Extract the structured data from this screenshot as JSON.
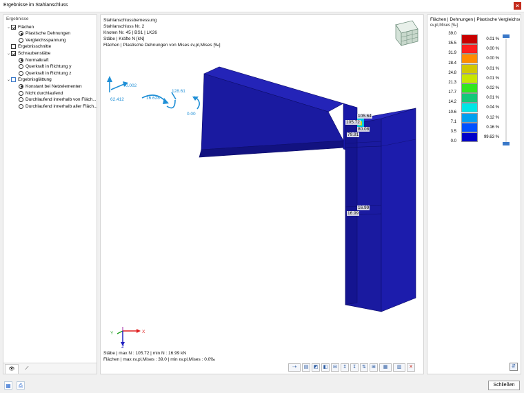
{
  "window": {
    "title": "Ergebnisse im Stahlanschluss",
    "close_glyph": "×"
  },
  "left_panel": {
    "header": "Ergebnisse",
    "tree": [
      {
        "type": "checkbox",
        "level": 0,
        "chevron": "⌄",
        "checked": true,
        "label": "Flächen"
      },
      {
        "type": "radio",
        "level": 1,
        "checked": true,
        "label": "Plastische Dehnungen"
      },
      {
        "type": "radio",
        "level": 1,
        "checked": false,
        "label": "Vergleichsspannung"
      },
      {
        "type": "checkbox",
        "level": 0,
        "chevron": "",
        "checked": false,
        "label": "Ergebnisschnitte"
      },
      {
        "type": "checkbox",
        "level": 0,
        "chevron": "⌄",
        "checked": true,
        "label": "Schraubenstäbe"
      },
      {
        "type": "radio",
        "level": 1,
        "checked": true,
        "label": "Normalkraft"
      },
      {
        "type": "radio",
        "level": 1,
        "checked": false,
        "label": "Querkraft in Richtung y"
      },
      {
        "type": "radio",
        "level": 1,
        "checked": false,
        "label": "Querkraft in Richtung z"
      },
      {
        "type": "checkbox",
        "level": 0,
        "chevron": "⌄",
        "checked": false,
        "partial": true,
        "label": "Ergebnisglättung"
      },
      {
        "type": "radio",
        "level": 1,
        "checked": true,
        "label": "Konstant bei Netzelementen"
      },
      {
        "type": "radio",
        "level": 1,
        "checked": false,
        "label": "Nicht durchlaufend"
      },
      {
        "type": "radio",
        "level": 1,
        "checked": false,
        "label": "Durchlaufend innerhalb von Fläch..."
      },
      {
        "type": "radio",
        "level": 1,
        "checked": false,
        "label": "Durchlaufend innerhalb aller Fläch..."
      }
    ],
    "tabs": [
      {
        "icon": "eye-icon",
        "glyph": "👁"
      },
      {
        "icon": "bolt-icon",
        "glyph": "⟋"
      }
    ]
  },
  "viewport": {
    "info_lines": [
      "Stahlanschlussbemessung",
      "Stahlanschluss Nr. 2",
      "Knoten Nr. 45 | BS1 | LK26",
      "Stäbe | Kräfte N [kN]",
      "Flächen | Plastische Dehnungen von Mises εv,pl,Mises [‰]"
    ],
    "bottom_lines": [
      "Stäbe | max N : 105.72 | min N : 16.99 kN",
      "Flächen | max εv,pl,Mises : 39.0 | min εv,pl,Mises : 0.0‰"
    ],
    "load_labels": [
      "0.002",
      "62.412",
      "16.628",
      "128.61",
      "0.00"
    ],
    "bolt_labels": [
      "105.64",
      "105.72",
      "80.08",
      "79.91",
      "16.99",
      "16.99"
    ],
    "axis_labels": {
      "x": "X",
      "y": "Y",
      "z": "Z"
    },
    "colors": {
      "steel": "#1a1aa0",
      "steel_dark": "#121280",
      "steel_light": "#2424b8",
      "load": "#1f8fd6"
    }
  },
  "right_panel": {
    "title": "Flächen | Dehnungen | Plastische Vergleichsc",
    "subtitle": "εv,pl,Mises [‰]",
    "legend": [
      {
        "value": "39.0",
        "color": "#c80000",
        "pct": "0.01 %"
      },
      {
        "value": "35.5",
        "color": "#ff1e1e",
        "pct": "0.00 %"
      },
      {
        "value": "31.9",
        "color": "#ff8c00",
        "pct": "0.00 %"
      },
      {
        "value": "28.4",
        "color": "#d2c800",
        "pct": "0.01 %"
      },
      {
        "value": "24.8",
        "color": "#c8e600",
        "pct": "0.01 %"
      },
      {
        "value": "21.3",
        "color": "#32e61e",
        "pct": "0.02 %"
      },
      {
        "value": "17.7",
        "color": "#14c87a",
        "pct": "0.01 %"
      },
      {
        "value": "14.2",
        "color": "#00e6e6",
        "pct": "0.04 %"
      },
      {
        "value": "10.6",
        "color": "#00a0f0",
        "pct": "0.12 %"
      },
      {
        "value": "7.1",
        "color": "#0050ff",
        "pct": "0.16 %"
      },
      {
        "value": "3.5",
        "color": "#0000c8",
        "pct": "99.63 %"
      },
      {
        "value": "0.0",
        "color": "",
        "pct": ""
      }
    ],
    "slider_color": "#3a78c8"
  },
  "status": {
    "close_label": "Schließen"
  }
}
